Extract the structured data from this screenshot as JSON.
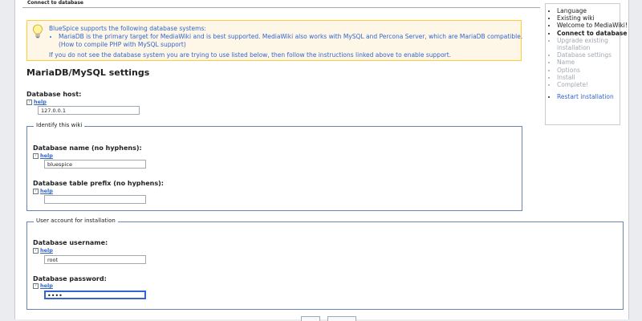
{
  "header": {
    "title": "Connect to database"
  },
  "notice": {
    "intro": "BlueSpice supports the following database systems:",
    "item_line1": "MariaDB is the primary target for MediaWiki and is best supported. MediaWiki also works with MySQL and Percona Server, which are MariaDB compatible.",
    "item_line2": "(How to compile PHP with MySQL support)",
    "instructions": "If you do not see the database system you are trying to use listed below, then follow the instructions linked above to enable support."
  },
  "section_title": "MariaDB/MySQL settings",
  "help_label": "help",
  "fields": {
    "db_host": {
      "label": "Database host:",
      "value": "127.0.0.1"
    },
    "db_name": {
      "label": "Database name (no hyphens):",
      "value": "bluespice"
    },
    "db_prefix": {
      "label": "Database table prefix (no hyphens):",
      "value": ""
    },
    "db_user": {
      "label": "Database username:",
      "value": "root"
    },
    "db_pass": {
      "label": "Database password:",
      "value": "••••"
    }
  },
  "fieldsets": {
    "identify": "Identify this wiki",
    "account": "User account for installation"
  },
  "sidebar": {
    "items": [
      {
        "label": "Language",
        "state": "done"
      },
      {
        "label": "Existing wiki",
        "state": "done"
      },
      {
        "label": "Welcome to MediaWiki!",
        "state": "done"
      },
      {
        "label": "Connect to database",
        "state": "current"
      },
      {
        "label": "Upgrade existing installation",
        "state": "disabled"
      },
      {
        "label": "Database settings",
        "state": "disabled"
      },
      {
        "label": "Name",
        "state": "disabled"
      },
      {
        "label": "Options",
        "state": "disabled"
      },
      {
        "label": "Install",
        "state": "disabled"
      },
      {
        "label": "Complete!",
        "state": "disabled"
      }
    ],
    "restart": "Restart installation"
  },
  "colors": {
    "link": "#3366cc",
    "notice_bg": "#fef6e7",
    "notice_border": "#ffcc33",
    "fieldset_border": "#6a85b5",
    "focus": "#3366cc"
  }
}
